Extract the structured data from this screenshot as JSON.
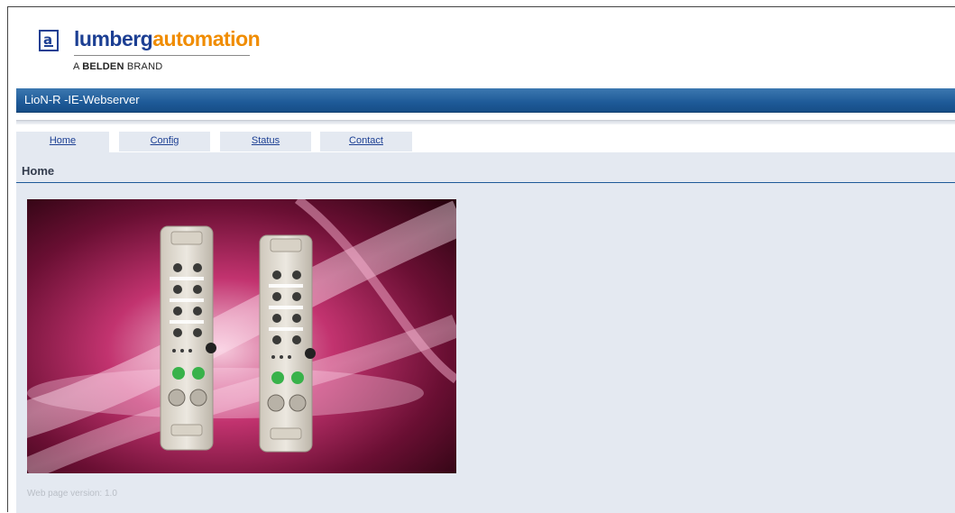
{
  "brand": {
    "logo_letter": "a",
    "name_part1": "lumberg",
    "name_part2": "automation",
    "sub_prefix": "A ",
    "sub_bold": "BELDEN",
    "sub_suffix": " BRAND"
  },
  "header": {
    "title": "LioN-R -IE-Webserver"
  },
  "tabs": [
    {
      "label": "Home",
      "active": true
    },
    {
      "label": "Config",
      "active": false
    },
    {
      "label": "Status",
      "active": false
    },
    {
      "label": "Contact",
      "active": false
    }
  ],
  "page": {
    "heading": "Home"
  },
  "image": {
    "icon": "io-module-product-image"
  },
  "footer": {
    "version": "Web page version: 1.0"
  },
  "colors": {
    "brand_blue": "#1c3f93",
    "brand_orange": "#f08c00",
    "title_bar": "#1e5a98",
    "panel": "#e4e9f1"
  }
}
